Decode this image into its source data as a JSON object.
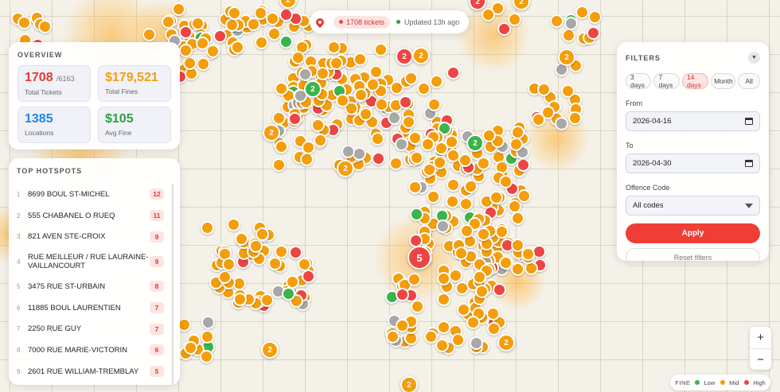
{
  "status": {
    "tickets_label": "1708 tickets",
    "updated_label": "Updated 13h ago"
  },
  "overview": {
    "title": "OVERVIEW",
    "stats": [
      {
        "value": "1708",
        "sub": "/6163",
        "label": "Total Tickets",
        "color": "#e53935"
      },
      {
        "value": "$179,521",
        "sub": "",
        "label": "Total Fines",
        "color": "#f59e0b"
      },
      {
        "value": "1385",
        "sub": "",
        "label": "Locations",
        "color": "#1e88e5"
      },
      {
        "value": "$105",
        "sub": "",
        "label": "Avg Fine",
        "color": "#2e9e45"
      }
    ]
  },
  "hotspots": {
    "title": "TOP HOTSPOTS",
    "items": [
      {
        "rank": "1",
        "name": "8699 BOUL ST-MICHEL",
        "count": "12"
      },
      {
        "rank": "2",
        "name": "555 CHABANEL O RUEQ",
        "count": "11"
      },
      {
        "rank": "3",
        "name": "821 AVEN STE-CROIX",
        "count": "9"
      },
      {
        "rank": "4",
        "name": "RUE MEILLEUR / RUE LAURAINE-VAILLANCOURT",
        "count": "9"
      },
      {
        "rank": "5",
        "name": "3475 RUE ST-URBAIN",
        "count": "8"
      },
      {
        "rank": "6",
        "name": "11885 BOUL LAURENTIEN",
        "count": "7"
      },
      {
        "rank": "7",
        "name": "2250 RUE GUY",
        "count": "7"
      },
      {
        "rank": "8",
        "name": "7000 RUE MARIE-VICTORIN",
        "count": "6"
      },
      {
        "rank": "9",
        "name": "2601 RUE WILLIAM-TREMBLAY",
        "count": "5"
      }
    ]
  },
  "filters": {
    "title": "FILTERS",
    "ranges": [
      "3 days",
      "7 days",
      "14 days",
      "Month",
      "All"
    ],
    "active_range": "14 days",
    "from_label": "From",
    "from_value": "2026-04-16",
    "to_label": "To",
    "to_value": "2026-04-30",
    "offence_label": "Offence Code",
    "offence_value": "All codes",
    "apply_label": "Apply",
    "reset_label": "Reset filters"
  },
  "zoom": {
    "in": "+",
    "out": "−"
  },
  "legend": {
    "title": "FINE",
    "low": "Low",
    "mid": "Mid",
    "high": "High",
    "low_color": "#3bb44a",
    "mid_color": "#f59e0b",
    "high_color": "#ef4444"
  },
  "clusters": [
    {
      "count": "2",
      "level": "mid"
    },
    {
      "count": "2",
      "level": "mid"
    },
    {
      "count": "2",
      "level": "mid"
    },
    {
      "count": "2",
      "level": "mid"
    },
    {
      "count": "2",
      "level": "mid"
    },
    {
      "count": "2",
      "level": "low"
    },
    {
      "count": "2",
      "level": "low"
    },
    {
      "count": "2",
      "level": "high"
    },
    {
      "count": "2",
      "level": "high"
    },
    {
      "count": "2",
      "level": "mid"
    },
    {
      "count": "2",
      "level": "mid"
    },
    {
      "count": "5",
      "level": "high"
    },
    {
      "count": "2",
      "level": "mid"
    },
    {
      "count": "2",
      "level": "mid"
    }
  ]
}
